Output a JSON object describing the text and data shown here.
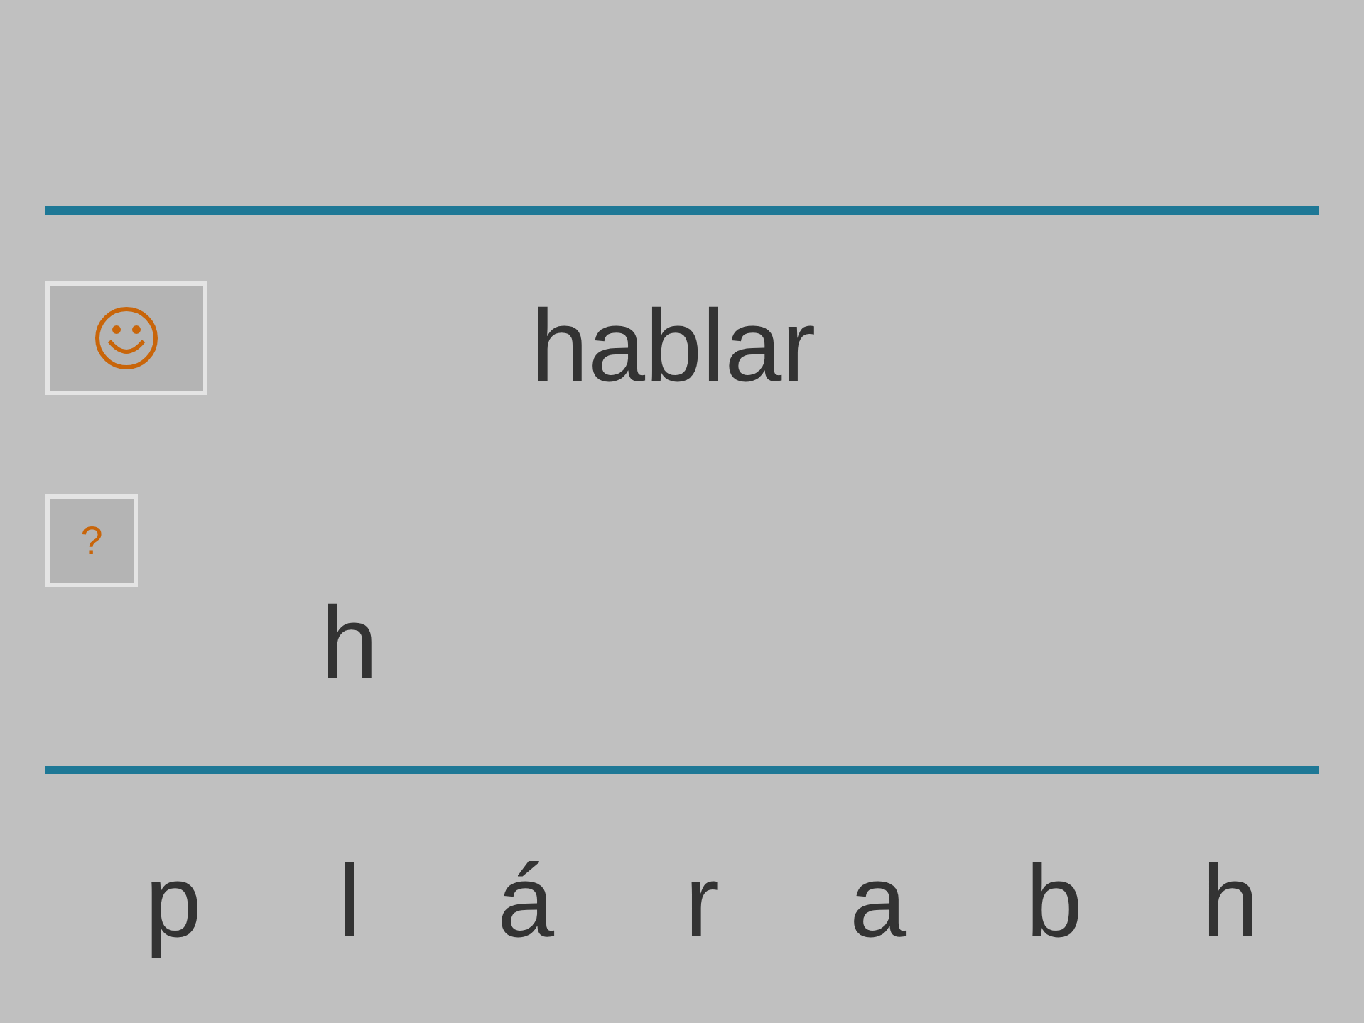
{
  "word": "hablar",
  "help_button": {
    "label": "?"
  },
  "answer": "h",
  "letters": [
    "p",
    "l",
    "á",
    "r",
    "a",
    "b",
    "h"
  ]
}
